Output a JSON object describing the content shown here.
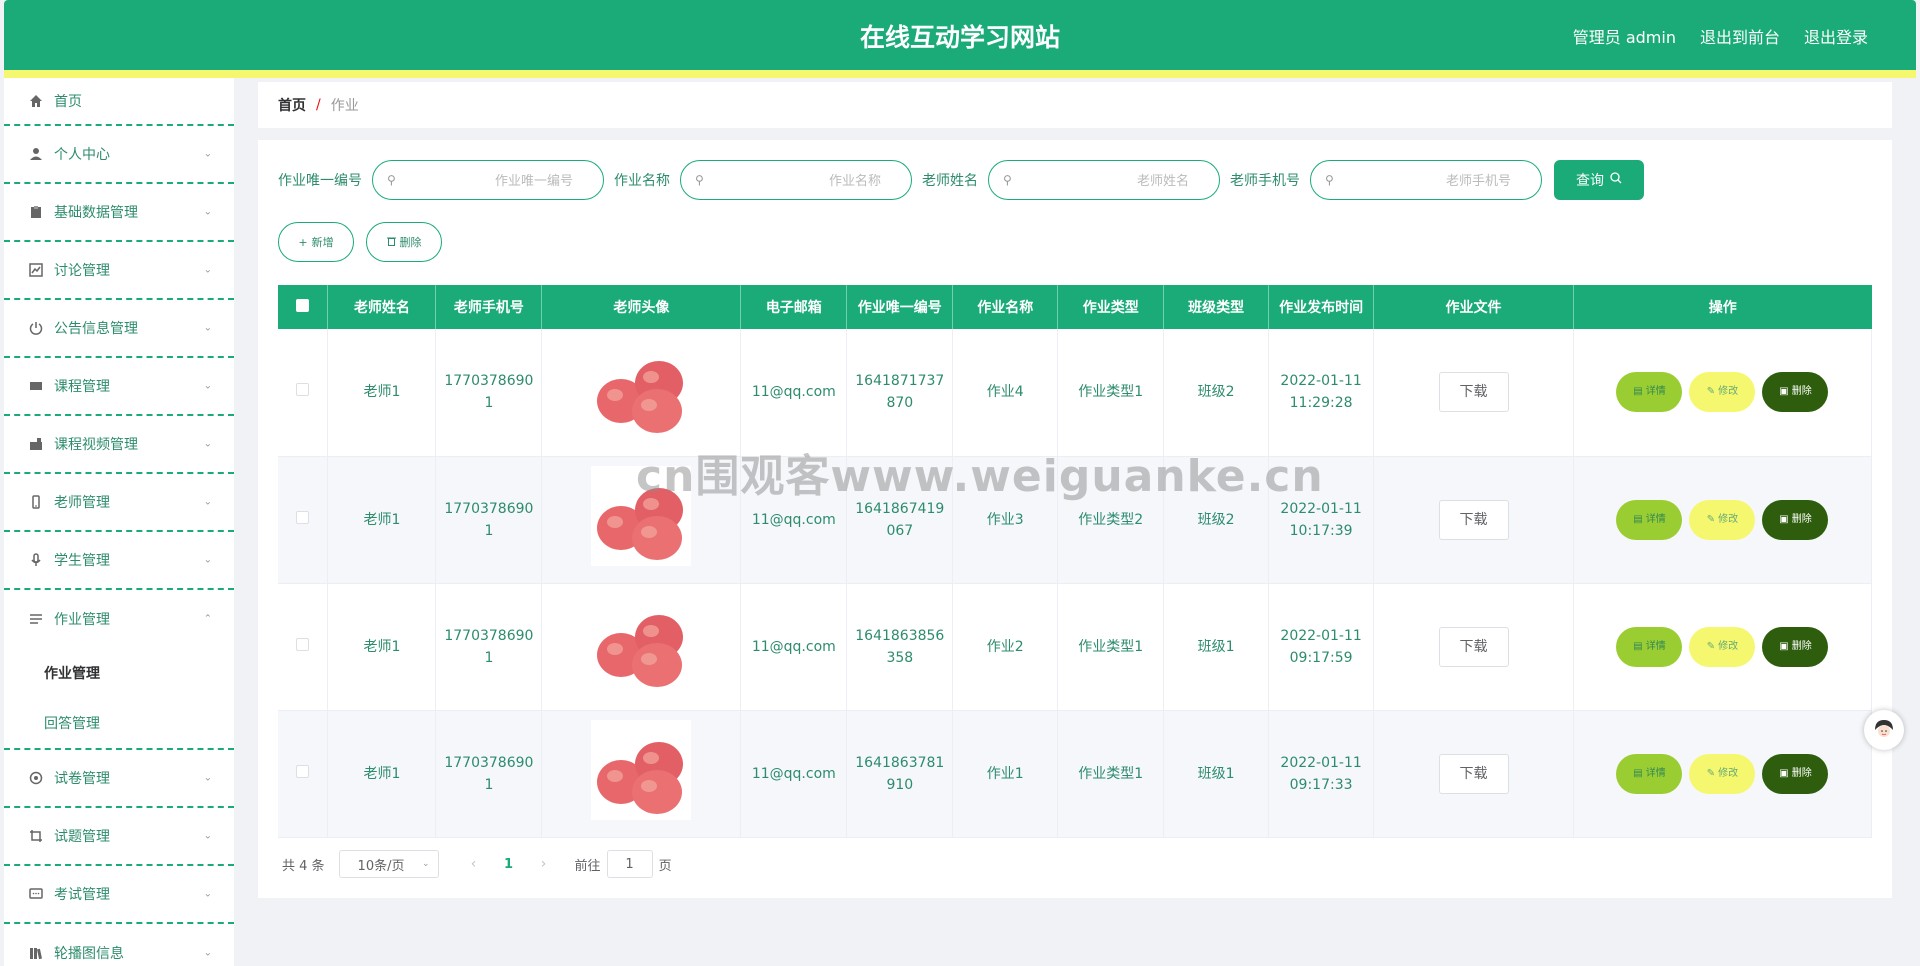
{
  "header": {
    "title": "在线互动学习网站",
    "admin_label": "管理员 admin",
    "front_label": "退出到前台",
    "logout_label": "退出登录"
  },
  "colors": {
    "primary": "#1aab79",
    "stripe": "#f5f86e",
    "detail_btn": "#9acd32",
    "edit_btn": "#f5f86e",
    "delete_btn": "#2e5e0d"
  },
  "sidebar": {
    "items": [
      {
        "label": "首页",
        "icon": "home-icon"
      },
      {
        "label": "个人中心",
        "icon": "user-icon"
      },
      {
        "label": "基础数据管理",
        "icon": "clipboard-icon"
      },
      {
        "label": "讨论管理",
        "icon": "chart-icon"
      },
      {
        "label": "公告信息管理",
        "icon": "power-icon"
      },
      {
        "label": "课程管理",
        "icon": "ticket-icon"
      },
      {
        "label": "课程视频管理",
        "icon": "video-icon"
      },
      {
        "label": "老师管理",
        "icon": "phone-icon"
      },
      {
        "label": "学生管理",
        "icon": "microphone-icon"
      },
      {
        "label": "作业管理",
        "icon": "list-icon"
      },
      {
        "label": "试卷管理",
        "icon": "circle-icon"
      },
      {
        "label": "试题管理",
        "icon": "crop-icon"
      },
      {
        "label": "考试管理",
        "icon": "message-icon"
      },
      {
        "label": "轮播图信息",
        "icon": "book-icon"
      }
    ],
    "sub_items": [
      "作业管理",
      "回答管理"
    ]
  },
  "breadcrumb": {
    "home": "首页",
    "separator": "/",
    "current": "作业"
  },
  "search": {
    "fields": [
      {
        "label": "作业唯一编号",
        "placeholder": "作业唯一编号"
      },
      {
        "label": "作业名称",
        "placeholder": "作业名称"
      },
      {
        "label": "老师姓名",
        "placeholder": "老师姓名"
      },
      {
        "label": "老师手机号",
        "placeholder": "老师手机号"
      }
    ],
    "query_label": "查询"
  },
  "actions": {
    "add_label": "新增",
    "delete_label": "删除"
  },
  "table": {
    "headers": [
      "老师姓名",
      "老师手机号",
      "老师头像",
      "电子邮箱",
      "作业唯一编号",
      "作业名称",
      "作业类型",
      "班级类型",
      "作业发布时间",
      "作业文件",
      "操作"
    ],
    "rows": [
      {
        "teacher": "老师1",
        "phone_a": "1770378690",
        "phone_b": "1",
        "email": "11@qq.com",
        "code_a": "1641871737",
        "code_b": "870",
        "name": "作业4",
        "type": "作业类型1",
        "class": "班级2",
        "date": "2022-01-11",
        "time": "11:29:28"
      },
      {
        "teacher": "老师1",
        "phone_a": "1770378690",
        "phone_b": "1",
        "email": "11@qq.com",
        "code_a": "1641867419",
        "code_b": "067",
        "name": "作业3",
        "type": "作业类型2",
        "class": "班级2",
        "date": "2022-01-11",
        "time": "10:17:39"
      },
      {
        "teacher": "老师1",
        "phone_a": "1770378690",
        "phone_b": "1",
        "email": "11@qq.com",
        "code_a": "1641863856",
        "code_b": "358",
        "name": "作业2",
        "type": "作业类型1",
        "class": "班级1",
        "date": "2022-01-11",
        "time": "09:17:59"
      },
      {
        "teacher": "老师1",
        "phone_a": "1770378690",
        "phone_b": "1",
        "email": "11@qq.com",
        "code_a": "1641863781",
        "code_b": "910",
        "name": "作业1",
        "type": "作业类型1",
        "class": "班级1",
        "date": "2022-01-11",
        "time": "09:17:33"
      }
    ],
    "download_label": "下载",
    "detail_label": "详情",
    "edit_label": "修改",
    "delete_label": "删除"
  },
  "pagination": {
    "total": "共 4 条",
    "page_size": "10条/页",
    "current_page": "1",
    "goto_label": "前往",
    "goto_value": "1",
    "page_suffix": "页"
  },
  "watermark": "cn围观客www.weiguanke.cn"
}
